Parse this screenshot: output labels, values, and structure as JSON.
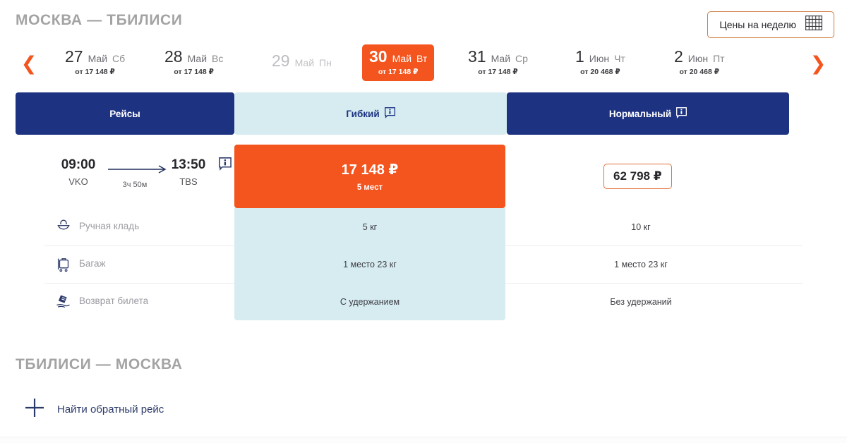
{
  "header": {
    "route_title": "МОСКВА — ТБИЛИСИ",
    "week_prices_label": "Цены на неделю",
    "calendar_icon": "calendar-grid-icon"
  },
  "date_strip": {
    "prev_arrow": "❮",
    "next_arrow": "❯",
    "days": [
      {
        "num": "27",
        "month": "Май",
        "weekday": "Сб",
        "price": "от 17 148 ₽",
        "state": "normal"
      },
      {
        "num": "28",
        "month": "Май",
        "weekday": "Вс",
        "price": "от 17 148 ₽",
        "state": "normal"
      },
      {
        "num": "29",
        "month": "Май",
        "weekday": "Пн",
        "price": "",
        "state": "disabled"
      },
      {
        "num": "30",
        "month": "Май",
        "weekday": "Вт",
        "price": "от 17 148 ₽",
        "state": "selected"
      },
      {
        "num": "31",
        "month": "Май",
        "weekday": "Ср",
        "price": "от 17 148 ₽",
        "state": "normal"
      },
      {
        "num": "1",
        "month": "Июн",
        "weekday": "Чт",
        "price": "от 20 468 ₽",
        "state": "normal"
      },
      {
        "num": "2",
        "month": "Июн",
        "weekday": "Пт",
        "price": "от 20 468 ₽",
        "state": "normal"
      }
    ]
  },
  "tabs": [
    {
      "label": "Рейсы",
      "style": "dark",
      "has_info": false
    },
    {
      "label": "Гибкий",
      "style": "light",
      "has_info": true
    },
    {
      "label": "Нормальный",
      "style": "dark",
      "has_info": true
    }
  ],
  "flight": {
    "depart_time": "09:00",
    "depart_code": "VKO",
    "arrive_time": "13:50",
    "arrive_code": "TBS",
    "duration": "3ч 50м",
    "info_icon": "info-bubble-icon",
    "price_main": {
      "value": "17 148 ₽",
      "seats": "5 мест"
    },
    "price_alt": {
      "value": "62 798 ₽"
    },
    "features": [
      {
        "icon": "handbag-icon",
        "label": "Ручная кладь",
        "flexible": "5 кг",
        "normal": "10 кг"
      },
      {
        "icon": "luggage-icon",
        "label": "Багаж",
        "flexible": "1 место 23 кг",
        "normal": "1 место 23 кг"
      },
      {
        "icon": "refund-icon",
        "label": "Возврат билета",
        "flexible": "С удержанием",
        "normal": "Без удержаний"
      }
    ]
  },
  "return_section": {
    "title": "ТБИЛИСИ — МОСКВА",
    "add_label": "Найти обратный рейс",
    "plus_icon": "plus-icon"
  },
  "colors": {
    "orange": "#f4541e",
    "dark_blue": "#1d3382",
    "light_blue": "#d6ecf0",
    "title_gray": "#a3a3a3",
    "outline_orange": "#e0703a"
  }
}
